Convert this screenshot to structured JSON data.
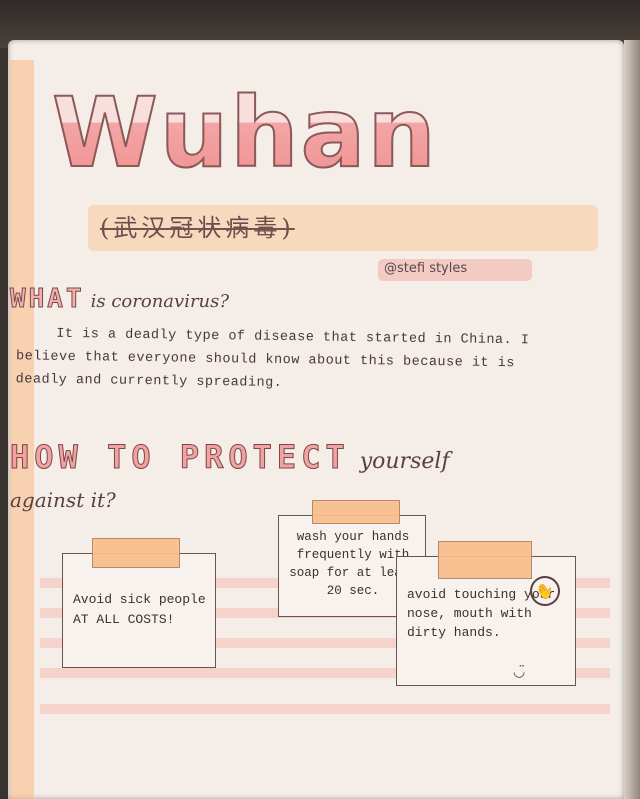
{
  "title": "Wuhan",
  "chinese_name": "(武汉冠状病毒)",
  "handle": "@stefi styles",
  "what": {
    "heading": "WHAT",
    "rest": "is coronavirus?"
  },
  "paragraph": "It is a deadly type of disease that started in China. I believe that everyone should know about this because it is deadly and currently spreading.",
  "how": {
    "heading": "HOW TO PROTECT",
    "rest": "yourself",
    "line2": "against it?"
  },
  "notes": [
    {
      "text": "Avoid sick people AT ALL COSTS!"
    },
    {
      "text": "wash your hands frequently with soap for at least 20 sec."
    },
    {
      "text": "avoid touching your nose, mouth with dirty hands."
    }
  ],
  "face_glyph": "◡̈",
  "no_sign_glyph": "✋",
  "colors": {
    "accent_pink": "#f2a2a2",
    "tape_orange": "#f8be8c",
    "paper": "#f5eee8"
  }
}
